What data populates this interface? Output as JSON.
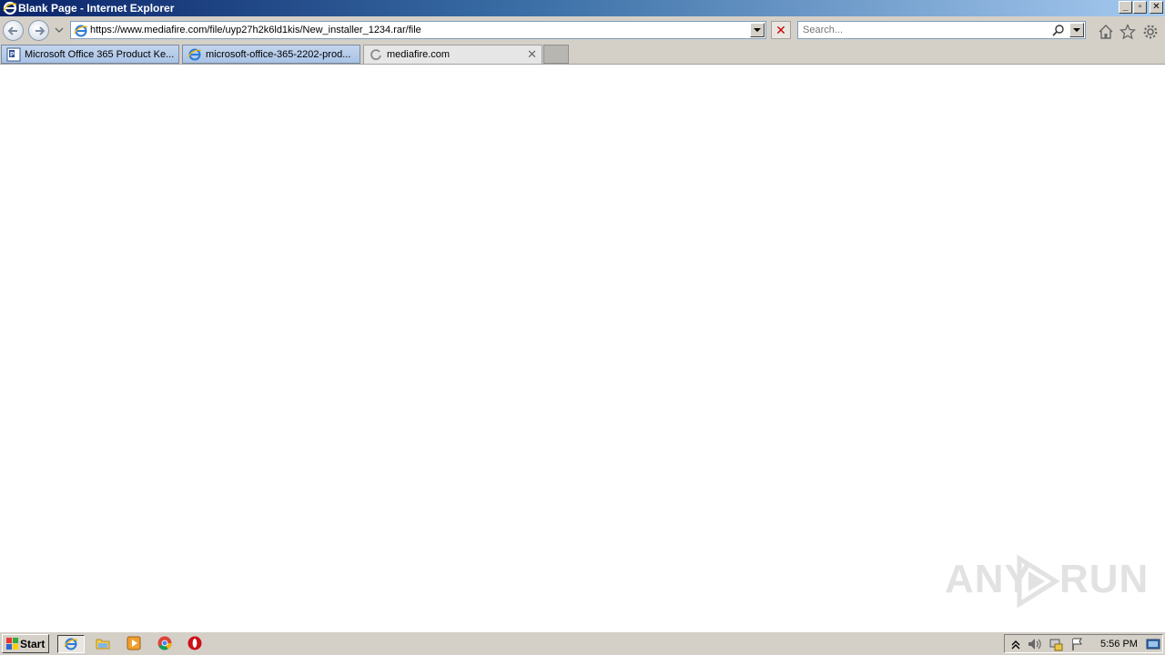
{
  "window": {
    "title": "Blank Page - Internet Explorer"
  },
  "navbar": {
    "url": "https://www.mediafire.com/file/uyp27h2k6ld1kis/New_installer_1234.rar/file",
    "search_placeholder": "Search..."
  },
  "tabs": [
    {
      "label": "Microsoft Office 365 Product Ke...",
      "icon": "web-page-icon",
      "active": false
    },
    {
      "label": "microsoft-office-365-2202-prod...",
      "icon": "ie-icon",
      "active": false
    },
    {
      "label": "mediafire.com",
      "icon": "loading-spinner-icon",
      "active": true
    }
  ],
  "watermark": {
    "left": "ANY",
    "right": "RUN"
  },
  "taskbar": {
    "start_label": "Start",
    "clock": "5:56 PM"
  },
  "colors": {
    "title_gradient_start": "#0a246a",
    "title_gradient_end": "#a6caf0",
    "chrome": "#d4d0c8",
    "stop_red": "#cc0000"
  }
}
